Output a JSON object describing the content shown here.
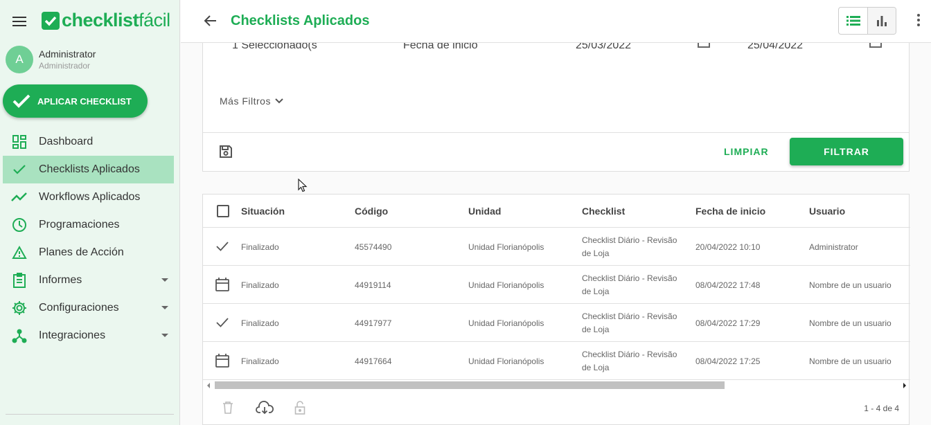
{
  "app": {
    "logo_bold": "checklist",
    "logo_light": "fácil",
    "brand_color": "#1ead55"
  },
  "user": {
    "initial": "A",
    "name": "Administrator",
    "role": "Administrador"
  },
  "apply_button": {
    "label": "APLICAR CHECKLIST"
  },
  "sidebar": {
    "items": [
      {
        "label": "Dashboard",
        "icon": "dashboard-icon"
      },
      {
        "label": "Checklists Aplicados",
        "icon": "check-icon",
        "active": true
      },
      {
        "label": "Workflows Aplicados",
        "icon": "trending-icon"
      },
      {
        "label": "Programaciones",
        "icon": "clock-icon"
      },
      {
        "label": "Planes de Acción",
        "icon": "warning-icon"
      },
      {
        "label": "Informes",
        "icon": "clipboard-icon",
        "expandable": true
      },
      {
        "label": "Configuraciones",
        "icon": "gear-icon",
        "expandable": true
      },
      {
        "label": "Integraciones",
        "icon": "integration-icon",
        "expandable": true
      }
    ]
  },
  "header": {
    "title": "Checklists Aplicados"
  },
  "filters": {
    "selected": "1 Seleccionado(s",
    "date_field_label": "Fecha de inicio",
    "date_from": "25/03/2022",
    "date_to": "25/04/2022",
    "more_filters": "Más Filtros",
    "clear_label": "LIMPIAR",
    "filter_label": "FILTRAR"
  },
  "table": {
    "headers": [
      "Situación",
      "Código",
      "Unidad",
      "Checklist",
      "Fecha de inicio",
      "Usuario"
    ],
    "rows": [
      {
        "icon": "check-icon",
        "situacion": "Finalizado",
        "codigo": "45574490",
        "unidad": "Unidad Florianópolis",
        "checklist": "Checklist Diário - Revisão de Loja",
        "fecha": "20/04/2022 10:10",
        "usuario": "Administrator"
      },
      {
        "icon": "calendar-icon",
        "situacion": "Finalizado",
        "codigo": "44919114",
        "unidad": "Unidad Florianópolis",
        "checklist": "Checklist Diário - Revisão de Loja",
        "fecha": "08/04/2022 17:48",
        "usuario": "Nombre de un usuario"
      },
      {
        "icon": "check-icon",
        "situacion": "Finalizado",
        "codigo": "44917977",
        "unidad": "Unidad Florianópolis",
        "checklist": "Checklist Diário - Revisão de Loja",
        "fecha": "08/04/2022 17:29",
        "usuario": "Nombre de un usuario"
      },
      {
        "icon": "calendar-icon",
        "situacion": "Finalizado",
        "codigo": "44917664",
        "unidad": "Unidad Florianópolis",
        "checklist": "Checklist Diário - Revisão de Loja",
        "fecha": "08/04/2022 17:25",
        "usuario": "Nombre de un usuario"
      }
    ],
    "pagination": "1 - 4 de 4"
  }
}
